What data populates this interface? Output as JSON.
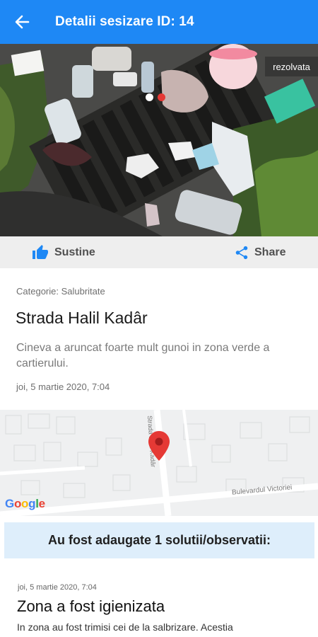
{
  "header": {
    "title": "Detalii sesizare ID: 14"
  },
  "photo": {
    "status": "rezolvata",
    "colors": {
      "dot_active": "#e53935",
      "dot_inactive": "#ffffff"
    }
  },
  "actions": {
    "support_label": "Sustine",
    "share_label": "Share"
  },
  "report": {
    "category": "Categorie: Salubritate",
    "street": "Strada Halil Kadâr",
    "description": "Cineva a aruncat foarte mult gunoi in zona verde a cartierului.",
    "date": "joi, 5 martie 2020, 7:04"
  },
  "map": {
    "street_label_vertical": "Strada Halil Kadâr",
    "street_label_horizontal": "Bulevardul Victoriei",
    "logo": "Google"
  },
  "solutions": {
    "banner": "Au fost adaugate 1 solutii/observatii:",
    "items": [
      {
        "date": "joi, 5 martie 2020, 7:04",
        "title": "Zona a fost igienizata",
        "text": "In zona au fost trimisi cei de la salbrizare. Acestia"
      }
    ]
  },
  "colors": {
    "appbar": "#1e88f5",
    "accent": "#1e88f5",
    "banner_bg": "#deeefb",
    "pin": "#e53935"
  }
}
